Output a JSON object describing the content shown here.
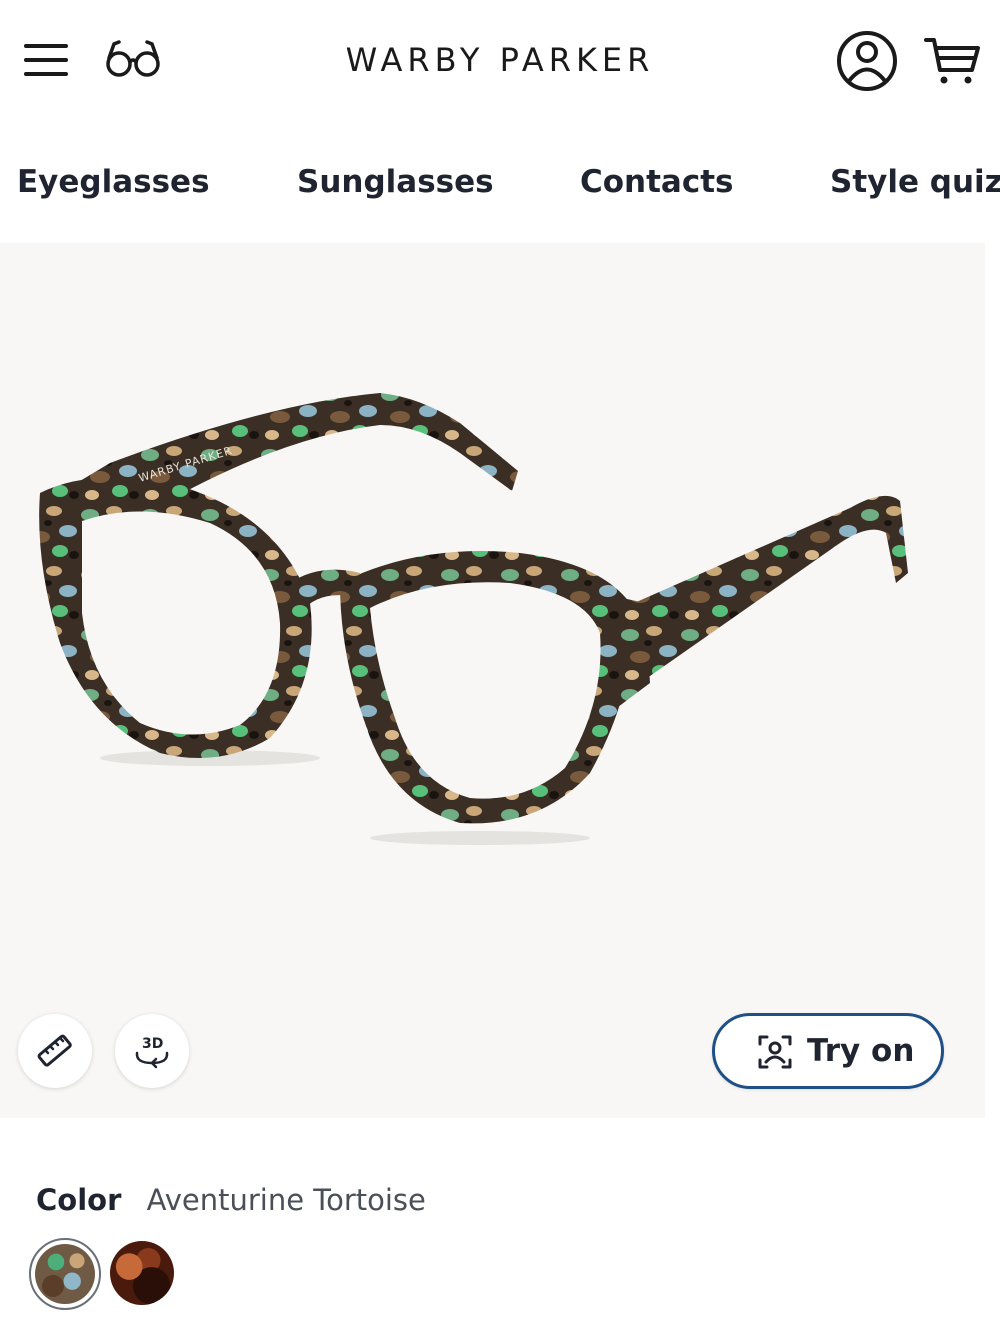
{
  "header": {
    "brand": "WARBY PARKER",
    "menu_icon": "hamburger-menu-icon",
    "glasses_icon": "eyeglasses-icon",
    "account_icon": "user-account-icon",
    "cart_icon": "shopping-cart-icon"
  },
  "nav": {
    "items": [
      {
        "label": "Eyeglasses"
      },
      {
        "label": "Sunglasses"
      },
      {
        "label": "Contacts"
      },
      {
        "label": "Style quiz"
      }
    ]
  },
  "product": {
    "image_icon": "cat-eye-eyeglasses-frame",
    "frame_engraving": "WARBY PARKER",
    "measure_icon": "ruler-icon",
    "view_3d_label": "3D",
    "view_3d_icon": "rotate-3d-icon",
    "try_on_label": "Try on",
    "try_on_icon": "face-scan-icon"
  },
  "color": {
    "label": "Color",
    "selected_name": "Aventurine Tortoise",
    "swatches": [
      {
        "name": "Aventurine Tortoise",
        "selected": true
      },
      {
        "name": "tortoise",
        "selected": false
      }
    ]
  },
  "colors": {
    "text": "#1a1a1a",
    "hero_background": "#f8f7f5",
    "try_on_border": "#1e4f86",
    "secondary_text": "#4a4f58"
  }
}
